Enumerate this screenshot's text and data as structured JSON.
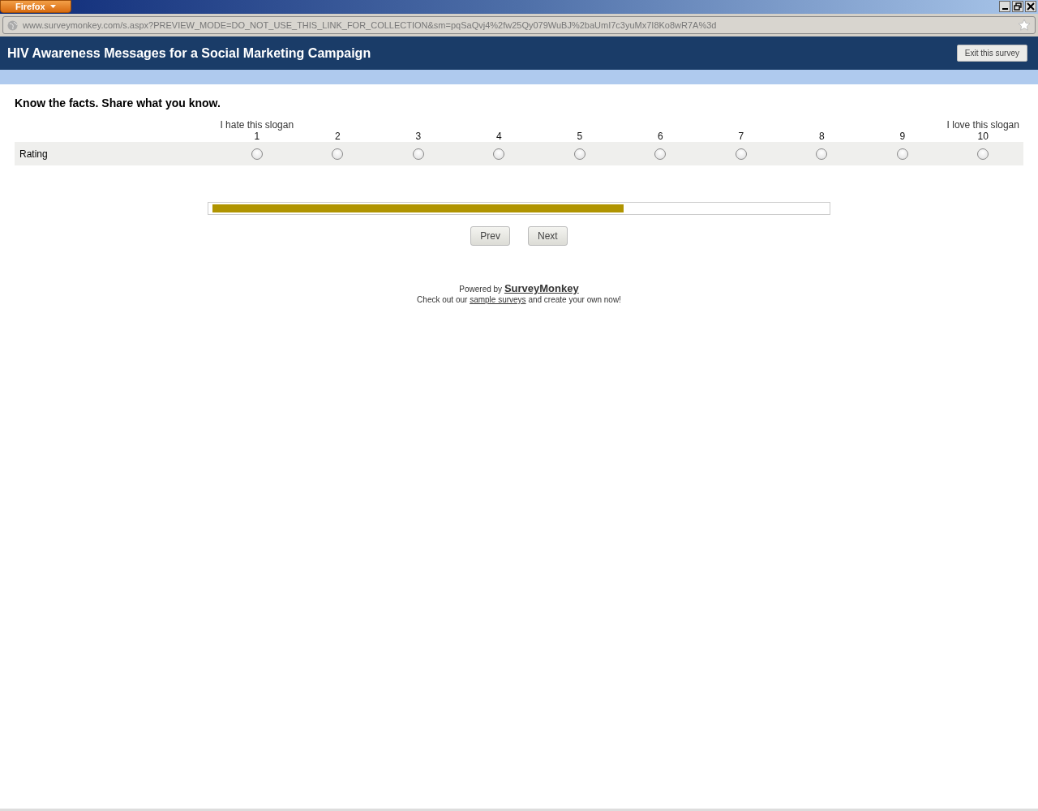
{
  "browser": {
    "menu_label": "Firefox",
    "url": "www.surveymonkey.com/s.aspx?PREVIEW_MODE=DO_NOT_USE_THIS_LINK_FOR_COLLECTION&sm=pqSaQvj4%2fw25Qy079WuBJ%2baUmI7c3yuMx7I8Ko8wR7A%3d"
  },
  "survey": {
    "title": "HIV Awareness Messages for a Social Marketing Campaign",
    "exit_button": "Exit this survey"
  },
  "question": {
    "text": "Know the facts. Share what you know.",
    "columns": [
      {
        "label": "I hate this slogan",
        "number": "1"
      },
      {
        "number": "2"
      },
      {
        "number": "3"
      },
      {
        "number": "4"
      },
      {
        "number": "5"
      },
      {
        "number": "6"
      },
      {
        "number": "7"
      },
      {
        "number": "8"
      },
      {
        "number": "9"
      },
      {
        "label": "I love this slogan",
        "number": "10"
      }
    ],
    "rows": [
      {
        "label": "Rating",
        "choices": [
          {
            "selected": false
          },
          {
            "selected": false
          },
          {
            "selected": false
          },
          {
            "selected": false
          },
          {
            "selected": false
          },
          {
            "selected": false
          },
          {
            "selected": false
          },
          {
            "selected": false
          },
          {
            "selected": false
          },
          {
            "selected": false
          }
        ]
      }
    ]
  },
  "progress": {
    "level": 0.67
  },
  "buttons": [
    "Prev",
    "Next"
  ],
  "footer": {
    "powered_by": "Powered by",
    "brand": "SurveyMonkey",
    "line_before": "Check out our",
    "link": "sample surveys",
    "line_after": "and create your own now!"
  }
}
